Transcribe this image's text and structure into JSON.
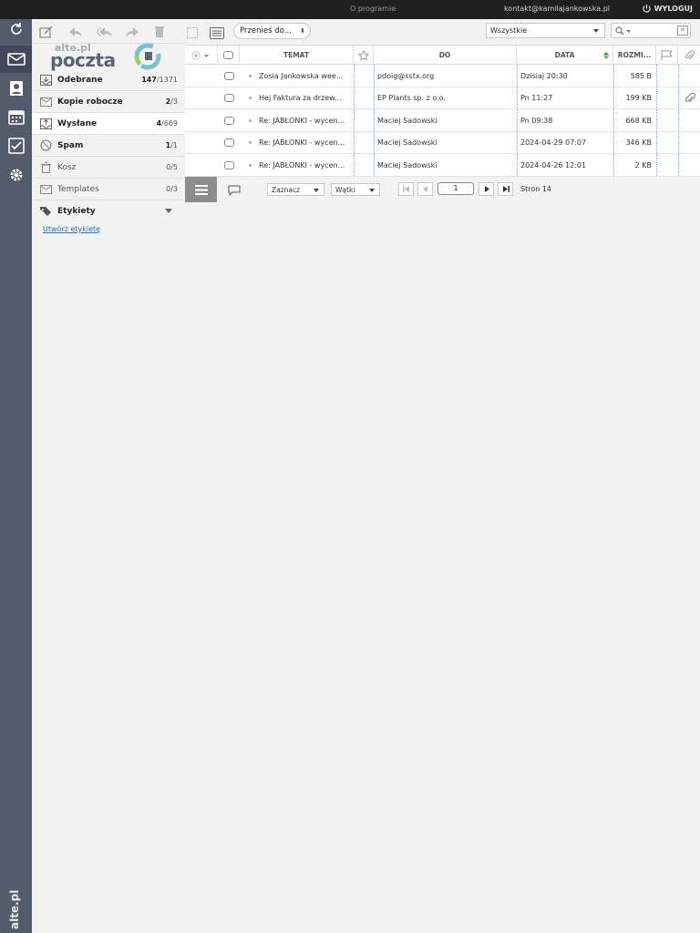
{
  "topbar": {
    "about": "O programie",
    "email": "kontakt@kamilajankowska.pl",
    "logout": "WYLOGUJ"
  },
  "rail": {
    "brand": "alte.pl",
    "icons": [
      "refresh-icon",
      "mail-icon",
      "contacts-icon",
      "calendar-icon",
      "tasks-icon",
      "settings-icon"
    ]
  },
  "logo": {
    "top_text": "alte.pl",
    "main_text": "poczta"
  },
  "folders": [
    {
      "name": "Odebrane",
      "unread": "147",
      "total": "/1371",
      "icon": "inbox-icon"
    },
    {
      "name": "Kopie robocze",
      "unread": "2",
      "total": "/3",
      "icon": "drafts-icon"
    },
    {
      "name": "Wysłane",
      "unread": "4",
      "total": "/669",
      "icon": "sent-icon"
    },
    {
      "name": "Spam",
      "unread": "1",
      "total": "/1",
      "icon": "spam-icon"
    },
    {
      "name": "Kosz",
      "unread": "",
      "total": "0/5",
      "icon": "trash-icon"
    },
    {
      "name": "Templates",
      "unread": "",
      "total": "0/3",
      "icon": "templates-icon"
    }
  ],
  "labels": {
    "title": "Etykiety",
    "create": "Utwórz etykietę"
  },
  "toolbar": {
    "move_to": "Przenieś do...",
    "filter": "Wszystkie"
  },
  "columns": {
    "subject": "TEMAT",
    "to": "DO",
    "date": "DATA",
    "size": "ROZMI..."
  },
  "messages": [
    {
      "subject": "Zosia Jankowska wee...",
      "to": "pdoig@sstx.org",
      "date": "Dzisiaj 20:30",
      "size": "585 B",
      "attachment": false
    },
    {
      "subject": "Hej Faktura za drzew...",
      "to": "EP Plants sp. z o.o.",
      "date": "Pn 11:27",
      "size": "199 KB",
      "attachment": true
    },
    {
      "subject": "Re: JABŁONKI - wycen...",
      "to": "Maciej Sadowski",
      "date": "Pn 09:38",
      "size": "668 KB",
      "attachment": false
    },
    {
      "subject": "Re: JABŁONKI - wycen...",
      "to": "Maciej Sadowski",
      "date": "2024-04-29 07:07",
      "size": "346 KB",
      "attachment": false
    },
    {
      "subject": "Re: JABŁONKI - wycen...",
      "to": "Maciej Sadowski",
      "date": "2024-04-26 12:01",
      "size": "2 KB",
      "attachment": false
    }
  ],
  "footer": {
    "select": "Zaznacz",
    "threads": "Wątki",
    "page": "1",
    "pages_label": "Stron 14"
  }
}
